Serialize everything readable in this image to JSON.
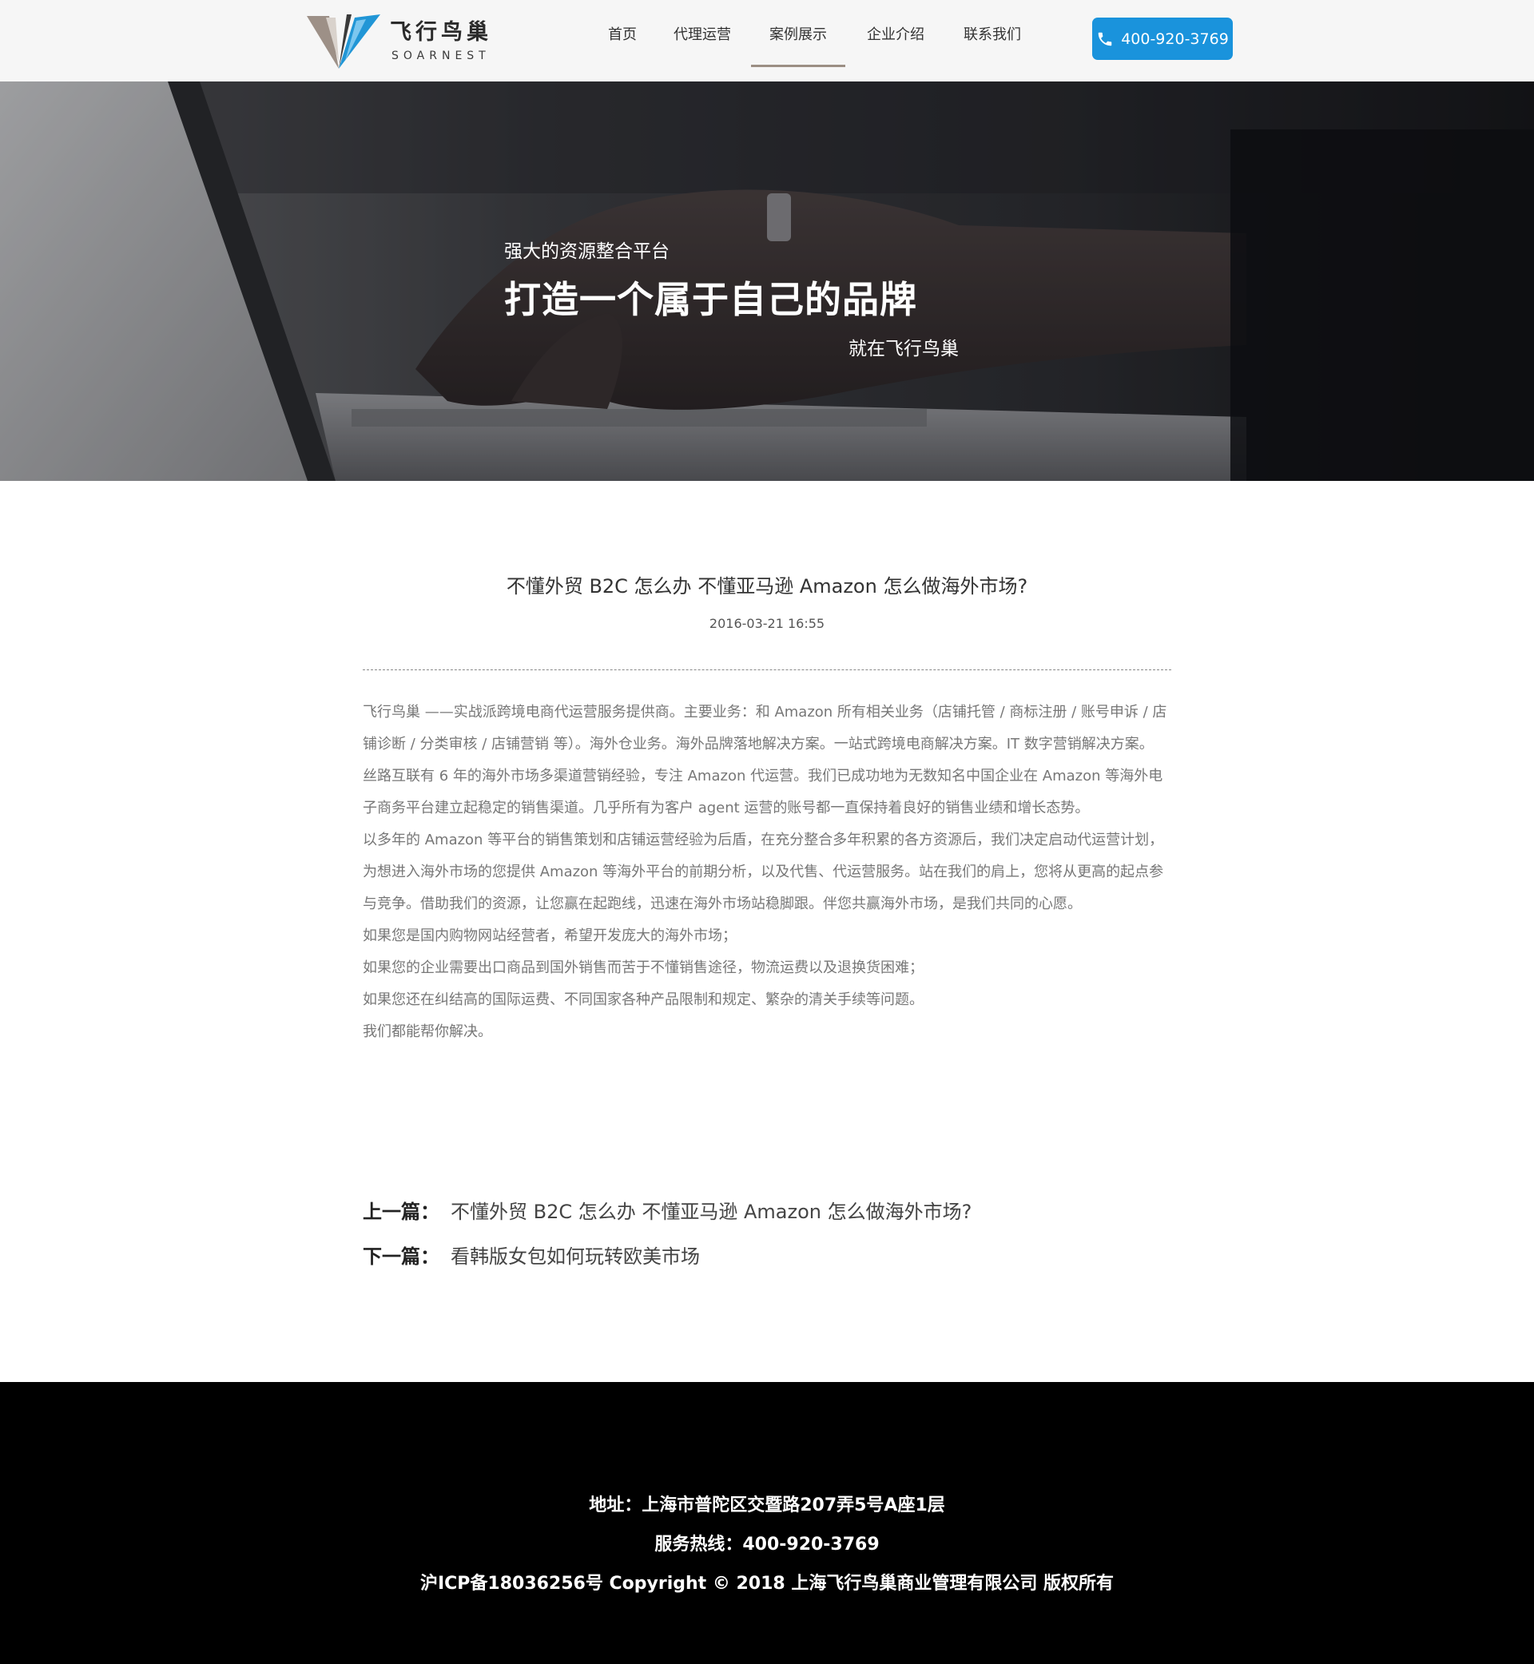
{
  "brand": {
    "name_cn": "飞行鸟巢",
    "name_en": "SOARNEST"
  },
  "nav": {
    "items": [
      {
        "label": "首页"
      },
      {
        "label": "代理运营"
      },
      {
        "label": "案例展示"
      },
      {
        "label": "企业介绍"
      },
      {
        "label": "联系我们"
      }
    ],
    "active": "案例展示"
  },
  "phone_button": {
    "label": "400-920-3769",
    "icon": "phone-icon"
  },
  "banner": {
    "subtitle": "强大的资源整合平台",
    "title": "打造一个属于自己的品牌",
    "tagline": "就在飞行鸟巢"
  },
  "article": {
    "title": "不懂外贸 B2C 怎么办  不懂亚马逊 Amazon  怎么做海外市场?",
    "date": "2016-03-21 16:55",
    "paragraphs": [
      "飞行鸟巢 ——实战派跨境电商代运营服务提供商。主要业务：和 Amazon 所有相关业务（店铺托管 / 商标注册 / 账号申诉 / 店铺诊断 / 分类审核 / 店铺营销  等）。海外仓业务。海外品牌落地解决方案。一站式跨境电商解决方案。IT 数字营销解决方案。",
      "丝路互联有 6 年的海外市场多渠道营销经验，专注 Amazon 代运营。我们已成功地为无数知名中国企业在 Amazon 等海外电子商务平台建立起稳定的销售渠道。几乎所有为客户 agent 运营的账号都一直保持着良好的销售业绩和增长态势。",
      "以多年的 Amazon 等平台的销售策划和店铺运营经验为后盾，在充分整合多年积累的各方资源后，我们决定启动代运营计划，为想进入海外市场的您提供 Amazon 等海外平台的前期分析，以及代售、代运营服务。站在我们的肩上，您将从更高的起点参与竞争。借助我们的资源，让您赢在起跑线，迅速在海外市场站稳脚跟。伴您共赢海外市场，是我们共同的心愿。",
      "如果您是国内购物网站经营者，希望开发庞大的海外市场；",
      "如果您的企业需要出口商品到国外销售而苦于不懂销售途径，物流运费以及退换货困难；",
      "如果您还在纠结高的国际运费、不同国家各种产品限制和规定、繁杂的清关手续等问题。",
      "我们都能帮你解决。"
    ]
  },
  "pagination": {
    "prev_label": "上一篇：",
    "prev_title": "不懂外贸 B2C 怎么办  不懂亚马逊 Amazon  怎么做海外市场?",
    "next_label": "下一篇：",
    "next_title": "看韩版女包如何玩转欧美市场"
  },
  "footer": {
    "address": "地址：上海市普陀区交暨路207弄5号A座1层",
    "hotline": "服务热线：400-920-3769",
    "copyright": "沪ICP备18036256号 Copyright © 2018 上海飞行鸟巢商业管理有限公司 版权所有"
  },
  "colors": {
    "accent": "#1a93dc",
    "nav_underline": "#9c8f84",
    "header_bg": "#f6f6f6",
    "footer_bg": "#000000",
    "body_text": "#777777"
  }
}
